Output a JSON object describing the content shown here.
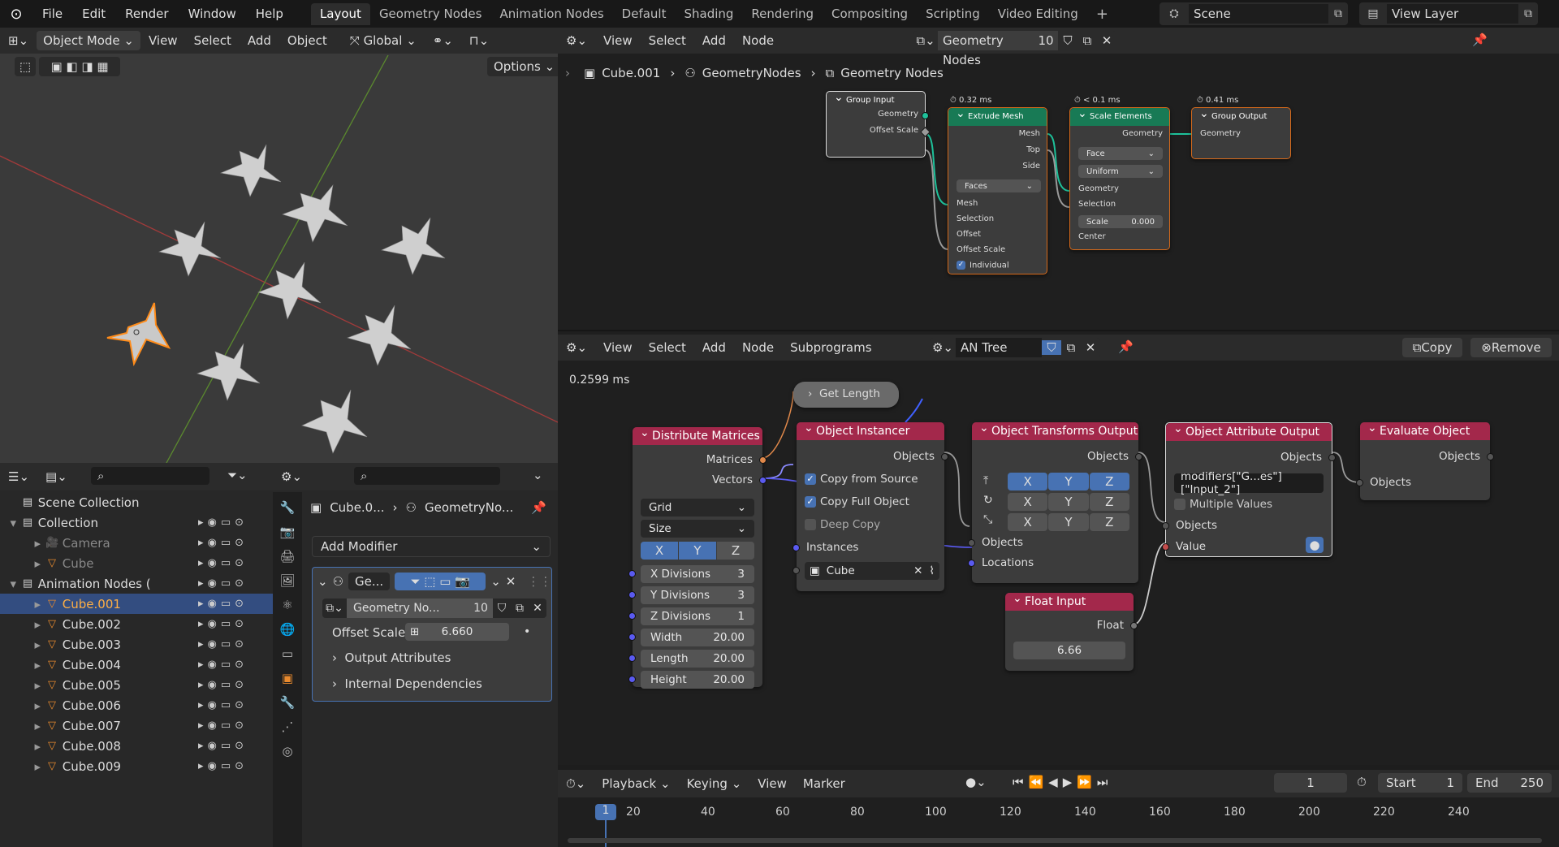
{
  "topbar": {
    "menus": [
      "File",
      "Edit",
      "Render",
      "Window",
      "Help"
    ],
    "workspaces": [
      "Layout",
      "Geometry Nodes",
      "Animation Nodes",
      "Default",
      "Shading",
      "Rendering",
      "Compositing",
      "Scripting",
      "Video Editing"
    ],
    "add": "+",
    "scene": "Scene",
    "view_layer": "View Layer"
  },
  "viewport": {
    "mode": "Object Mode",
    "menus": [
      "View",
      "Select",
      "Add",
      "Object"
    ],
    "orientation": "Global",
    "options": "Options"
  },
  "geo_editor": {
    "menus": [
      "View",
      "Select",
      "Add",
      "Node"
    ],
    "tree_name": "Geometry Nodes",
    "users": "10",
    "breadcrumb": [
      "Cube.001",
      "GeometryNodes",
      "Geometry Nodes"
    ],
    "nodes": {
      "group_input": {
        "title": "Group Input",
        "outs": [
          "Geometry",
          "Offset Scale"
        ]
      },
      "extrude": {
        "timing": "0.32 ms",
        "title": "Extrude Mesh",
        "outs": [
          "Mesh",
          "Top",
          "Side"
        ],
        "mode": "Faces",
        "ins": [
          "Mesh",
          "Selection",
          "Offset",
          "Offset Scale",
          "Individual"
        ]
      },
      "scale": {
        "timing": "< 0.1 ms",
        "title": "Scale Elements",
        "out": "Geometry",
        "domain": "Face",
        "mode": "Uniform",
        "ins": [
          "Geometry",
          "Selection"
        ],
        "scale_label": "Scale",
        "scale_value": "0.000",
        "center": "Center"
      },
      "group_output": {
        "timing": "0.41 ms",
        "title": "Group Output",
        "in": "Geometry"
      }
    }
  },
  "an_editor": {
    "menus": [
      "View",
      "Select",
      "Add",
      "Node",
      "Subprograms"
    ],
    "tree_name": "AN Tree",
    "copy": "Copy",
    "remove": "Remove",
    "timing": "0.2599 ms",
    "nodes": {
      "get_length": "Get Length",
      "distribute": {
        "title": "Distribute Matrices",
        "outs": [
          "Matrices",
          "Vectors"
        ],
        "mode": "Grid",
        "size": "Size",
        "axes": [
          "X",
          "Y",
          "Z"
        ],
        "fields": [
          {
            "l": "X Divisions",
            "v": "3"
          },
          {
            "l": "Y Divisions",
            "v": "3"
          },
          {
            "l": "Z Divisions",
            "v": "1"
          },
          {
            "l": "Width",
            "v": "20.00"
          },
          {
            "l": "Length",
            "v": "20.00"
          },
          {
            "l": "Height",
            "v": "20.00"
          }
        ]
      },
      "instancer": {
        "title": "Object Instancer",
        "out": "Objects",
        "opts": [
          "Copy from Source",
          "Copy Full Object",
          "Deep Copy"
        ],
        "instances": "Instances",
        "object": "Cube"
      },
      "transforms": {
        "title": "Object Transforms Output",
        "out": "Objects",
        "axes": [
          "X",
          "Y",
          "Z"
        ],
        "ins": [
          "Objects",
          "Locations"
        ]
      },
      "attribute": {
        "title": "Object Attribute Output",
        "out": "Objects",
        "path": "modifiers[\"G...es\"][\"Input_2\"]",
        "multi": "Multiple Values",
        "ins": [
          "Objects",
          "Value"
        ]
      },
      "evaluate": {
        "title": "Evaluate Object",
        "out": "Objects",
        "in": "Objects"
      },
      "float_input": {
        "title": "Float Input",
        "out": "Float",
        "value": "6.66"
      }
    }
  },
  "outliner": {
    "scene_collection": "Scene Collection",
    "items": [
      {
        "name": "Collection",
        "indent": 1
      },
      {
        "name": "Camera",
        "indent": 2,
        "dim": true
      },
      {
        "name": "Cube",
        "indent": 2,
        "dim": true
      },
      {
        "name": "Animation Nodes (",
        "indent": 1
      },
      {
        "name": "Cube.001",
        "indent": 2,
        "sel": true
      },
      {
        "name": "Cube.002",
        "indent": 2
      },
      {
        "name": "Cube.003",
        "indent": 2
      },
      {
        "name": "Cube.004",
        "indent": 2
      },
      {
        "name": "Cube.005",
        "indent": 2
      },
      {
        "name": "Cube.006",
        "indent": 2
      },
      {
        "name": "Cube.007",
        "indent": 2
      },
      {
        "name": "Cube.008",
        "indent": 2
      },
      {
        "name": "Cube.009",
        "indent": 2
      }
    ]
  },
  "properties": {
    "breadcrumb": [
      "Cube.0...",
      "GeometryNo..."
    ],
    "add_modifier": "Add Modifier",
    "modifier_short": "Ge...",
    "tree": "Geometry No...",
    "users": "10",
    "offset_label": "Offset Scale",
    "offset_value": "6.660",
    "sections": [
      "Output Attributes",
      "Internal Dependencies"
    ]
  },
  "timeline": {
    "menus": [
      "Playback",
      "Keying",
      "View",
      "Marker"
    ],
    "current": "1",
    "start_label": "Start",
    "start": "1",
    "end_label": "End",
    "end": "250",
    "ticks": [
      "20",
      "40",
      "60",
      "80",
      "100",
      "120",
      "140",
      "160",
      "180",
      "200",
      "220",
      "240"
    ],
    "cursor": "1"
  }
}
